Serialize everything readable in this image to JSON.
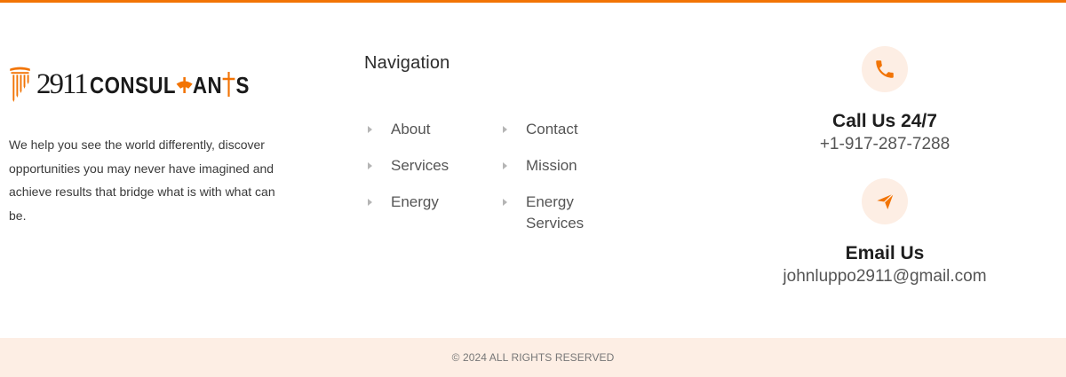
{
  "colors": {
    "accent": "#f27405",
    "accent_soft": "#fdeee4",
    "text": "#333333"
  },
  "brand": {
    "logo_number": "2911",
    "logo_word_1": "CONSUL",
    "logo_word_2": "AN",
    "logo_word_3": "S",
    "logo_icon": "pillar-icon",
    "description": "We help you see the world differently, discover opportunities you may never have imagined and achieve results that bridge what is with what can be."
  },
  "navigation": {
    "title": "Navigation",
    "items": [
      {
        "label": "About"
      },
      {
        "label": "Contact"
      },
      {
        "label": "Services"
      },
      {
        "label": "Mission"
      },
      {
        "label": "Energy"
      },
      {
        "label": "Energy Services"
      }
    ]
  },
  "contact": {
    "phone": {
      "icon": "phone-icon",
      "title": "Call Us 24/7",
      "value": "+1-917-287-7288"
    },
    "email": {
      "icon": "send-icon",
      "title": "Email Us",
      "value": "johnluppo2911@gmail.com"
    }
  },
  "footer": {
    "copyright": "© 2024 ALL RIGHTS RESERVED"
  }
}
